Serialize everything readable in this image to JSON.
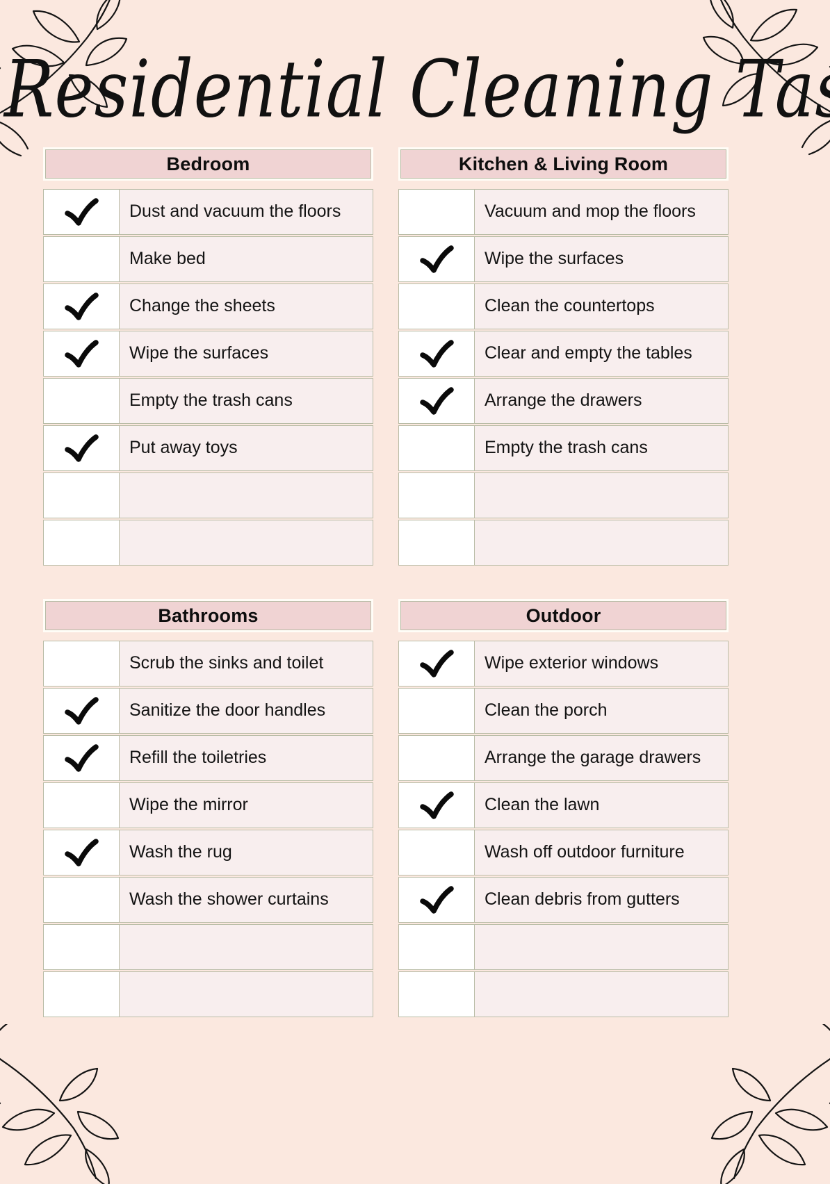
{
  "page": {
    "title": "Residential Cleaning Tasks",
    "background_color": "#FBE8DF",
    "header_fill_color": "#F0D3D3",
    "row_label_fill_color": "#F8EEEE",
    "check_cell_fill_color": "#FFFFFF",
    "border_color": "#B9BCA6",
    "text_color": "#131313"
  },
  "decorations": [
    {
      "name": "leaf-branch-top-left"
    },
    {
      "name": "leaf-branch-top-right"
    },
    {
      "name": "leaf-branch-bottom-left"
    },
    {
      "name": "leaf-branch-bottom-right"
    }
  ],
  "sections": [
    {
      "id": "bedroom",
      "title": "Bedroom",
      "tasks": [
        {
          "label": "Dust and vacuum the floors",
          "checked": true
        },
        {
          "label": "Make bed",
          "checked": false
        },
        {
          "label": "Change the sheets",
          "checked": true
        },
        {
          "label": "Wipe the surfaces",
          "checked": true
        },
        {
          "label": "Empty the trash cans",
          "checked": false
        },
        {
          "label": "Put away toys",
          "checked": true
        },
        {
          "label": "",
          "checked": false
        },
        {
          "label": "",
          "checked": false
        }
      ]
    },
    {
      "id": "kitchen-living-room",
      "title": "Kitchen & Living Room",
      "tasks": [
        {
          "label": "Vacuum and mop the floors",
          "checked": false
        },
        {
          "label": "Wipe the surfaces",
          "checked": true
        },
        {
          "label": "Clean the countertops",
          "checked": false
        },
        {
          "label": "Clear and empty the tables",
          "checked": true
        },
        {
          "label": "Arrange the drawers",
          "checked": true
        },
        {
          "label": "Empty the trash cans",
          "checked": false
        },
        {
          "label": "",
          "checked": false
        },
        {
          "label": "",
          "checked": false
        }
      ]
    },
    {
      "id": "bathrooms",
      "title": "Bathrooms",
      "tasks": [
        {
          "label": "Scrub the sinks and toilet",
          "checked": false
        },
        {
          "label": "Sanitize the door handles",
          "checked": true
        },
        {
          "label": "Refill the toiletries",
          "checked": true
        },
        {
          "label": "Wipe the mirror",
          "checked": false
        },
        {
          "label": "Wash the rug",
          "checked": true
        },
        {
          "label": "Wash the shower curtains",
          "checked": false
        },
        {
          "label": "",
          "checked": false
        },
        {
          "label": "",
          "checked": false
        }
      ]
    },
    {
      "id": "outdoor",
      "title": "Outdoor",
      "tasks": [
        {
          "label": "Wipe exterior windows",
          "checked": true
        },
        {
          "label": "Clean the porch",
          "checked": false
        },
        {
          "label": "Arrange the garage drawers",
          "checked": false
        },
        {
          "label": "Clean the lawn",
          "checked": true
        },
        {
          "label": "Wash off outdoor furniture",
          "checked": false
        },
        {
          "label": "Clean debris from gutters",
          "checked": true
        },
        {
          "label": "",
          "checked": false
        },
        {
          "label": "",
          "checked": false
        }
      ]
    }
  ]
}
